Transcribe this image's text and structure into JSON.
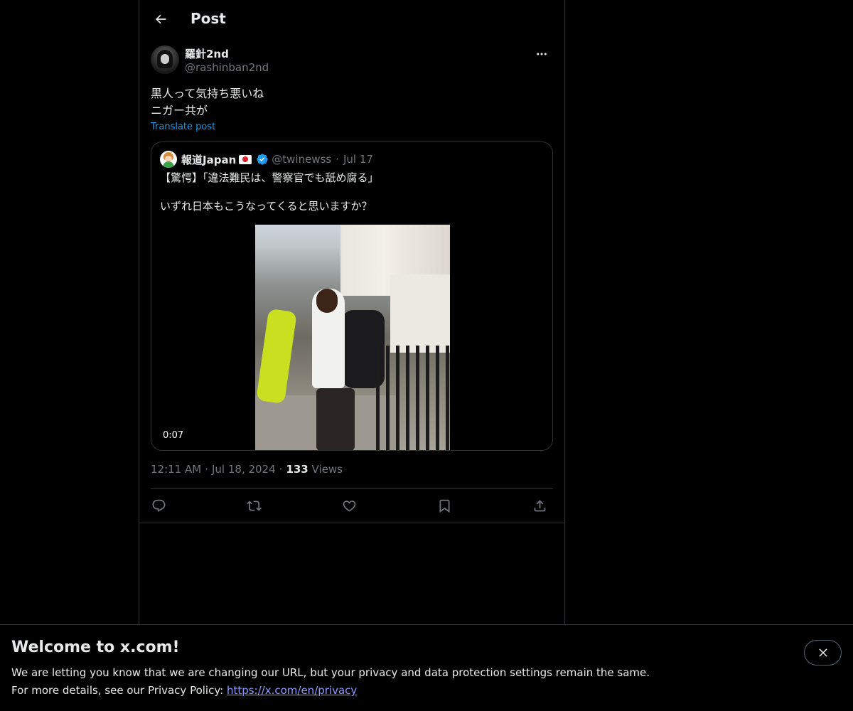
{
  "header": {
    "title": "Post"
  },
  "post": {
    "author_name": "羅針2nd",
    "author_handle": "@rashinban2nd",
    "text_line1": "黒人って気持ち悪いね",
    "text_line2": "ニガー共が",
    "translate_label": "Translate post",
    "time": "12:11 AM",
    "date": "Jul 18, 2024",
    "views_count": "133",
    "views_label": "Views",
    "meta_sep": "·"
  },
  "quote": {
    "author_name": "報道Japan",
    "handle": "@twinewss",
    "sep": "·",
    "date": "Jul 17",
    "text_line1": "【驚愕】「違法難民は、警察官でも舐め腐る」",
    "text_line2": "いずれ日本もこうなってくると思いますか？",
    "video_duration": "0:07"
  },
  "actions": [
    "reply-icon",
    "repost-icon",
    "like-icon",
    "bookmark-icon",
    "share-icon"
  ],
  "banner": {
    "title": "Welcome to x.com!",
    "line1": "We are letting you know that we are changing our URL, but your privacy and data protection settings remain the same.",
    "line2_prefix": "For more details, see our Privacy Policy: ",
    "link": "https://x.com/en/privacy"
  },
  "colors": {
    "background": "#000000",
    "text": "#e7e9ea",
    "muted": "#71767b",
    "accent": "#1d9bf0",
    "border": "#2f3336",
    "link": "#8f99ff"
  }
}
